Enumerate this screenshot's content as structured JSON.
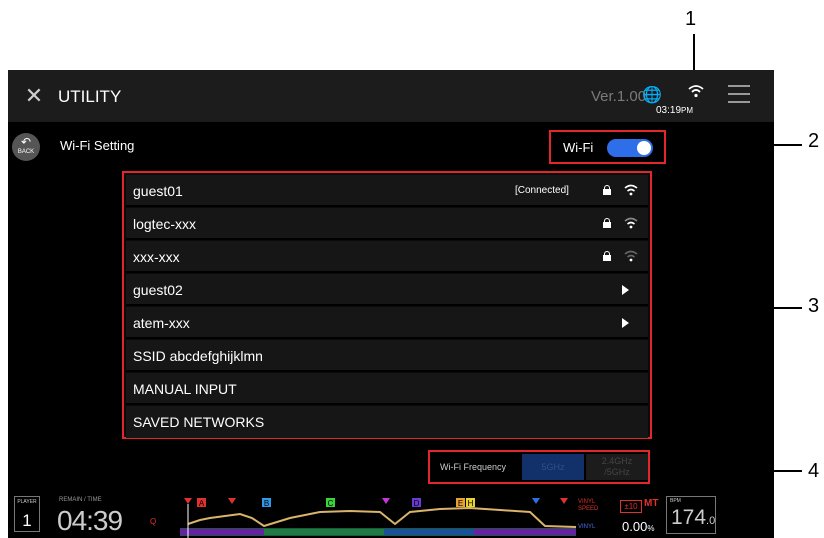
{
  "callouts": [
    "1",
    "2",
    "3",
    "4"
  ],
  "topbar": {
    "title": "UTILITY",
    "version": "Ver.1.00",
    "time": "03:19",
    "time_suffix": "PM",
    "close_icon": "✕",
    "globe_icon": "🌐"
  },
  "back": {
    "arrow": "↶",
    "label": "BACK"
  },
  "section_title": "Wi-Fi Setting",
  "wifi_toggle": {
    "label": "Wi-Fi",
    "state": "on"
  },
  "networks": [
    {
      "name": "guest01",
      "status": "[Connected]",
      "locked": true,
      "signal": "strong",
      "action": ""
    },
    {
      "name": "logtec-xxx",
      "status": "",
      "locked": true,
      "signal": "medium",
      "action": ""
    },
    {
      "name": "xxx-xxx",
      "status": "",
      "locked": true,
      "signal": "weak",
      "action": ""
    },
    {
      "name": "guest02",
      "status": "",
      "locked": false,
      "signal": "",
      "action": "arrow"
    },
    {
      "name": "atem-xxx",
      "status": "",
      "locked": false,
      "signal": "",
      "action": "arrow"
    },
    {
      "name": "SSID abcdefghijklmn",
      "status": "",
      "locked": false,
      "signal": "",
      "action": ""
    },
    {
      "name": "MANUAL INPUT",
      "status": "",
      "locked": false,
      "signal": "",
      "action": ""
    },
    {
      "name": "SAVED NETWORKS",
      "status": "",
      "locked": false,
      "signal": "",
      "action": ""
    }
  ],
  "frequency": {
    "label": "Wi-Fi Frequency",
    "option_5": "5GHz",
    "option_24_line1": "2.4GHz",
    "option_24_line2": "/5GHz"
  },
  "player": {
    "label": "PLAYER",
    "number": "1",
    "remain_label": "REMAIN",
    "time_label": "TIME",
    "time": "04:39",
    "q": "Q",
    "vinyl_speed_1": "VINYL",
    "vinyl_speed_2": "SPEED",
    "vinyl": "VINYL",
    "pitch_range": "±10",
    "mt": "MT",
    "pitch": "0.00",
    "pitch_unit": "%",
    "bpm_label": "BPM",
    "bpm": "174",
    "bpm_decimal": ".0",
    "hot_cues": [
      "A",
      "B",
      "C",
      "D",
      "E",
      "H"
    ]
  },
  "colors": {
    "callout_box": "#e3262b",
    "toggle_on": "#2f6ee9",
    "accent_red": "#e03030",
    "accent_blue": "#4a6df0"
  }
}
